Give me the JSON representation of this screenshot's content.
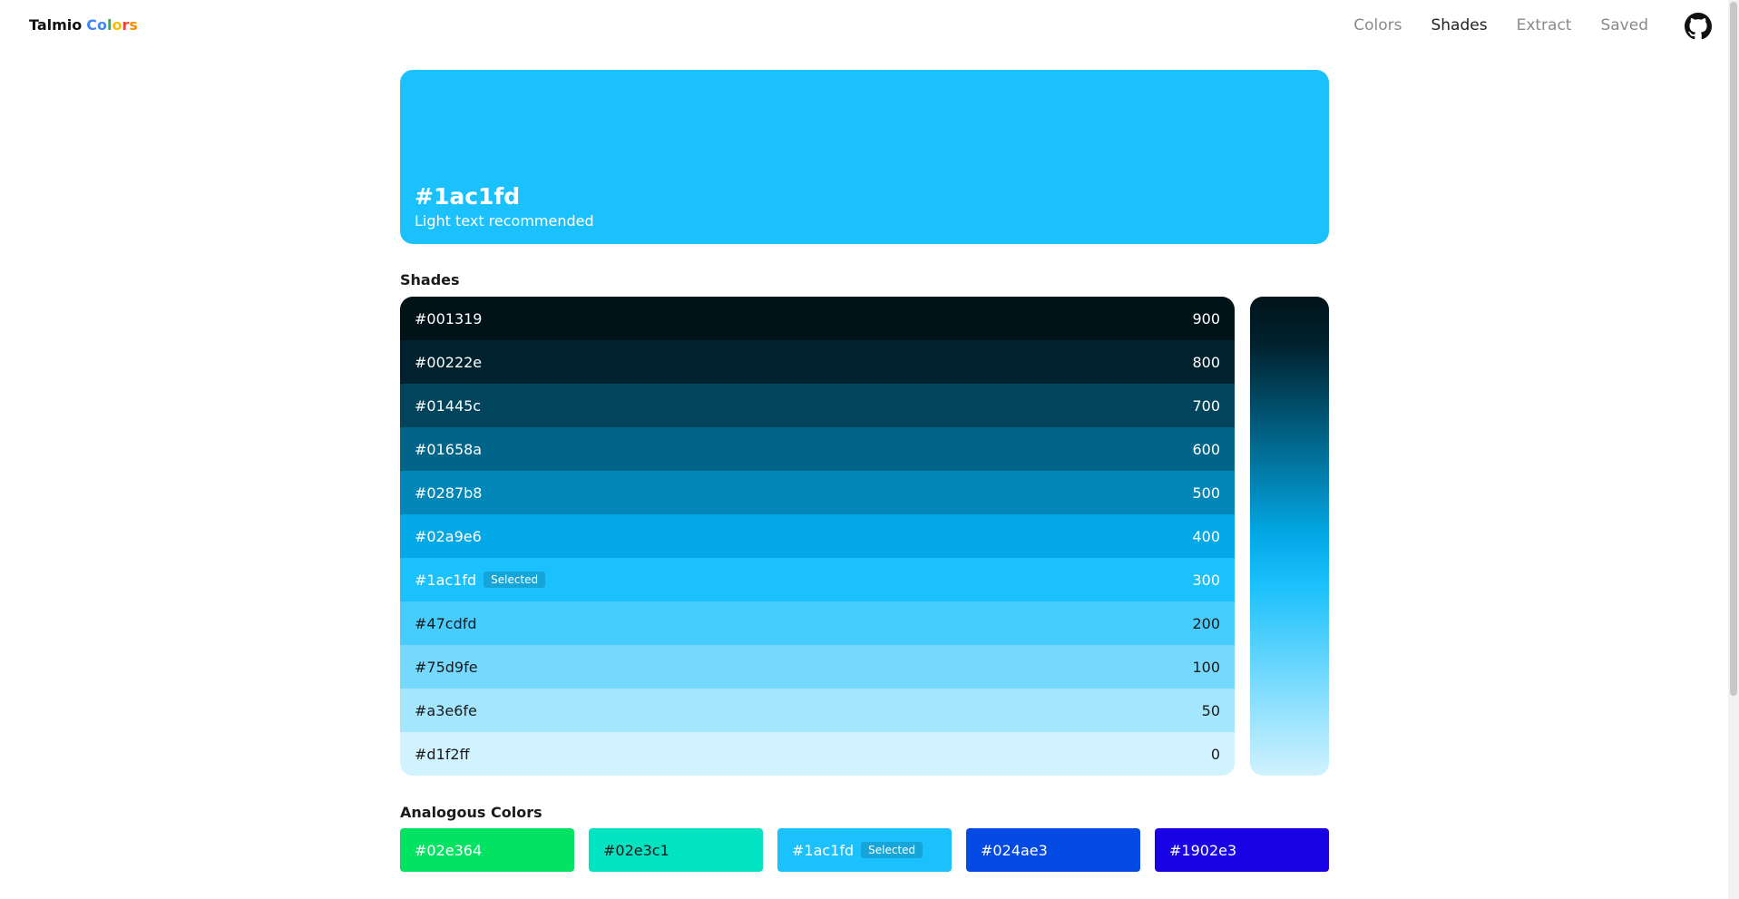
{
  "header": {
    "logo_word_1": "Talmio",
    "logo_word_2_letters": [
      {
        "ch": "C",
        "color": "#4285f4"
      },
      {
        "ch": "o",
        "color": "#4285f4"
      },
      {
        "ch": "l",
        "color": "#34a853"
      },
      {
        "ch": "o",
        "color": "#fbbc05"
      },
      {
        "ch": "r",
        "color": "#ea4335"
      },
      {
        "ch": "s",
        "color": "#fb8c00"
      }
    ],
    "nav": [
      {
        "label": "Colors",
        "active": false
      },
      {
        "label": "Shades",
        "active": true
      },
      {
        "label": "Extract",
        "active": false
      },
      {
        "label": "Saved",
        "active": false
      }
    ],
    "github_icon": "github-icon"
  },
  "hero": {
    "hex": "#1ac1fd",
    "note": "Light text recommended",
    "color": "#1ac1fd"
  },
  "shades": {
    "title": "Shades",
    "selected_badge": "Selected",
    "items": [
      {
        "hex": "#001319",
        "weight": "900",
        "color": "#001319",
        "text_color": "#ffffff",
        "selected": false
      },
      {
        "hex": "#00222e",
        "weight": "800",
        "color": "#00222e",
        "text_color": "#ffffff",
        "selected": false
      },
      {
        "hex": "#01445c",
        "weight": "700",
        "color": "#01445c",
        "text_color": "#ffffff",
        "selected": false
      },
      {
        "hex": "#01658a",
        "weight": "600",
        "color": "#01658a",
        "text_color": "#ffffff",
        "selected": false
      },
      {
        "hex": "#0287b8",
        "weight": "500",
        "color": "#0287b8",
        "text_color": "#ffffff",
        "selected": false
      },
      {
        "hex": "#02a9e6",
        "weight": "400",
        "color": "#02a9e6",
        "text_color": "#ffffff",
        "selected": false
      },
      {
        "hex": "#1ac1fd",
        "weight": "300",
        "color": "#1ac1fd",
        "text_color": "#ffffff",
        "selected": true
      },
      {
        "hex": "#47cdfd",
        "weight": "200",
        "color": "#47cdfd",
        "text_color": "#1a1a1a",
        "selected": false
      },
      {
        "hex": "#75d9fe",
        "weight": "100",
        "color": "#75d9fe",
        "text_color": "#1a1a1a",
        "selected": false
      },
      {
        "hex": "#a3e6fe",
        "weight": "50",
        "color": "#a3e6fe",
        "text_color": "#1a1a1a",
        "selected": false
      },
      {
        "hex": "#d1f2ff",
        "weight": "0",
        "color": "#d1f2ff",
        "text_color": "#1a1a1a",
        "selected": false
      }
    ]
  },
  "analogous": {
    "title": "Analogous Colors",
    "selected_badge": "Selected",
    "items": [
      {
        "hex": "#02e364",
        "color": "#02e364",
        "text_color": "#ffffff",
        "selected": false
      },
      {
        "hex": "#02e3c1",
        "color": "#02e3c1",
        "text_color": "#1a1a1a",
        "selected": false
      },
      {
        "hex": "#1ac1fd",
        "color": "#1ac1fd",
        "text_color": "#ffffff",
        "selected": true
      },
      {
        "hex": "#024ae3",
        "color": "#024ae3",
        "text_color": "#ffffff",
        "selected": false
      },
      {
        "hex": "#1902e3",
        "color": "#1902e3",
        "text_color": "#ffffff",
        "selected": false
      }
    ]
  }
}
